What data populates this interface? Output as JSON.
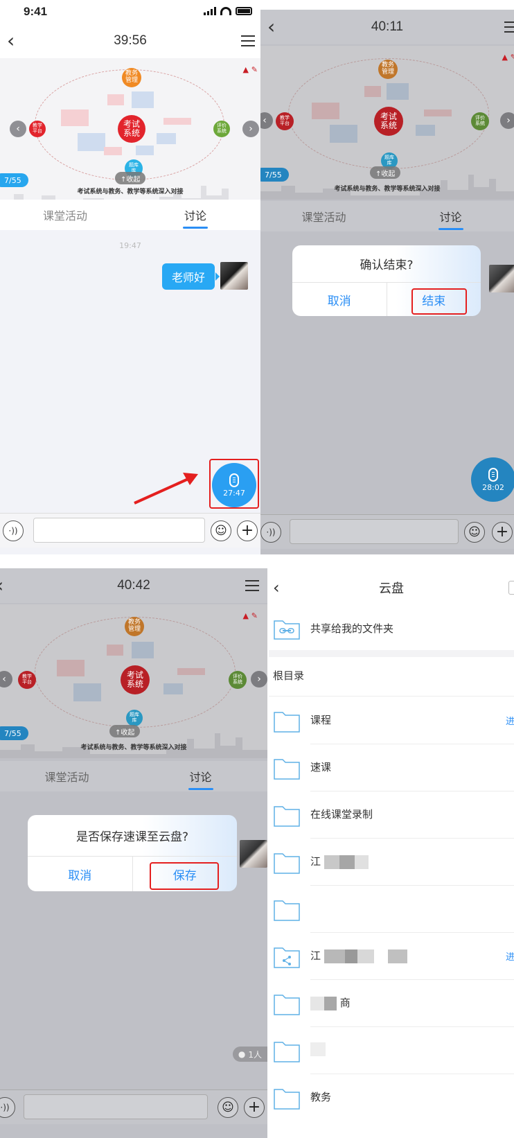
{
  "panel1": {
    "status_time": "9:41",
    "nav_title": "39:56",
    "page_indicator": "7/55",
    "slide_caption": "考试系统与教务、教学等系统深入对接",
    "collapse_label": "↑收起",
    "tabs": [
      "课堂活动",
      "讨论"
    ],
    "msg_time": "19:47",
    "msg_text": "老师好",
    "mic_time": "27:47"
  },
  "panel2": {
    "nav_title": "40:11",
    "page_indicator": "7/55",
    "slide_caption": "考试系统与教务、教学等系统深入对接",
    "collapse_label": "↑收起",
    "tabs": [
      "课堂活动",
      "讨论"
    ],
    "dialog_title": "确认结束?",
    "cancel_label": "取消",
    "confirm_label": "结束",
    "mic_time": "28:02"
  },
  "panel3": {
    "nav_title": "40:42",
    "page_indicator": "7/55",
    "slide_caption": "考试系统与教务、教学等系统深入对接",
    "collapse_label": "↑收起",
    "tabs": [
      "课堂活动",
      "讨论"
    ],
    "dialog_title": "是否保存速课至云盘?",
    "cancel_label": "取消",
    "confirm_label": "保存",
    "online_badge": "1人"
  },
  "slide_nodes": {
    "center": "考试\n系统",
    "top": "教务\n管理",
    "left": "教学\n平台",
    "right": "评价\n系统",
    "bottom": "题库\n库"
  },
  "cloud_disk": {
    "title": "云盘",
    "shared_folder": "共享给我的文件夹",
    "section_root": "根目录",
    "enter_label": "进入",
    "folders": [
      "课程",
      "速课",
      "在线课堂录制",
      "江",
      "",
      "江",
      "商",
      "",
      "教务"
    ]
  },
  "colors": {
    "accent": "#2a8ef5",
    "bubble_blue": "#28a8f4",
    "highlight_red": "#e41f1f",
    "dim_overlay": "#bfc0c6"
  }
}
